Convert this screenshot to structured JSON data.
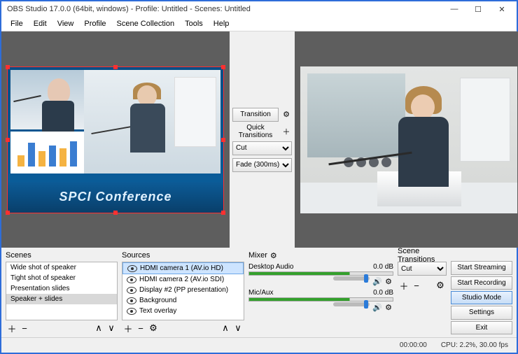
{
  "window": {
    "title": "OBS Studio 17.0.0 (64bit, windows) - Profile: Untitled - Scenes: Untitled"
  },
  "menus": [
    "File",
    "Edit",
    "View",
    "Profile",
    "Scene Collection",
    "Tools",
    "Help"
  ],
  "program_banner": "SPCI Conference",
  "center": {
    "transition_btn": "Transition",
    "quick_label": "Quick Transitions",
    "options": [
      "Cut",
      "Fade (300ms)"
    ]
  },
  "scenes": {
    "header": "Scenes",
    "items": [
      "Wide shot of speaker",
      "Tight shot of speaker",
      "Presentation slides",
      "Speaker + slides"
    ],
    "selected_index": 3
  },
  "sources": {
    "header": "Sources",
    "items": [
      "HDMI camera 1 (AV.io HD)",
      "HDMI camera 2 (AV.io SDI)",
      "Display #2 (PP presentation)",
      "Background",
      "Text overlay"
    ],
    "selected_index": 0
  },
  "mixer": {
    "header": "Mixer",
    "tracks": [
      {
        "name": "Desktop Audio",
        "db": "0.0 dB"
      },
      {
        "name": "Mic/Aux",
        "db": "0.0 dB"
      }
    ]
  },
  "transitions": {
    "header": "Scene Transitions",
    "selected": "Cut"
  },
  "buttons": {
    "start_streaming": "Start Streaming",
    "start_recording": "Start Recording",
    "studio_mode": "Studio Mode",
    "settings": "Settings",
    "exit": "Exit"
  },
  "status": {
    "time": "00:00:00",
    "cpu": "CPU: 2.2%, 30.00 fps"
  }
}
